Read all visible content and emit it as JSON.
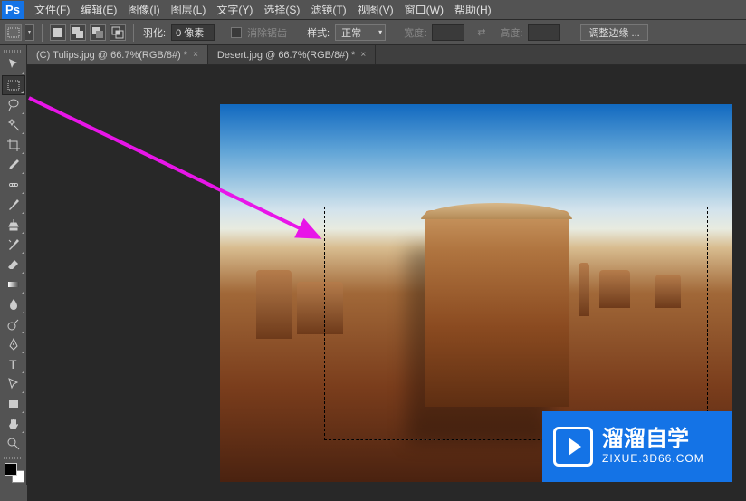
{
  "app": {
    "logo": "Ps"
  },
  "menu": {
    "file": "文件(F)",
    "edit": "编辑(E)",
    "image": "图像(I)",
    "layer": "图层(L)",
    "type": "文字(Y)",
    "select": "选择(S)",
    "filter": "滤镜(T)",
    "view": "视图(V)",
    "window": "窗口(W)",
    "help": "帮助(H)"
  },
  "options": {
    "feather_label": "羽化:",
    "feather_value": "0 像素",
    "antialias": "消除锯齿",
    "style_label": "样式:",
    "style_value": "正常",
    "width_label": "宽度:",
    "height_label": "高度:",
    "refine_edge": "调整边缘 ..."
  },
  "tabs": [
    {
      "label": "(C) Tulips.jpg @ 66.7%(RGB/8#) *",
      "active": false
    },
    {
      "label": "Desert.jpg @ 66.7%(RGB/8#) *",
      "active": true
    }
  ],
  "tools": [
    "move",
    "marquee",
    "lasso",
    "magic-wand",
    "crop",
    "eyedropper",
    "spot-heal",
    "brush",
    "clone-stamp",
    "history-brush",
    "eraser",
    "gradient",
    "blur",
    "dodge",
    "pen",
    "type",
    "path-select",
    "rectangle",
    "hand",
    "zoom"
  ],
  "watermark": {
    "title": "溜溜自学",
    "url": "ZIXUE.3D66.COM"
  },
  "colors": {
    "accent": "#1473e6",
    "arrow": "#e815e8"
  }
}
